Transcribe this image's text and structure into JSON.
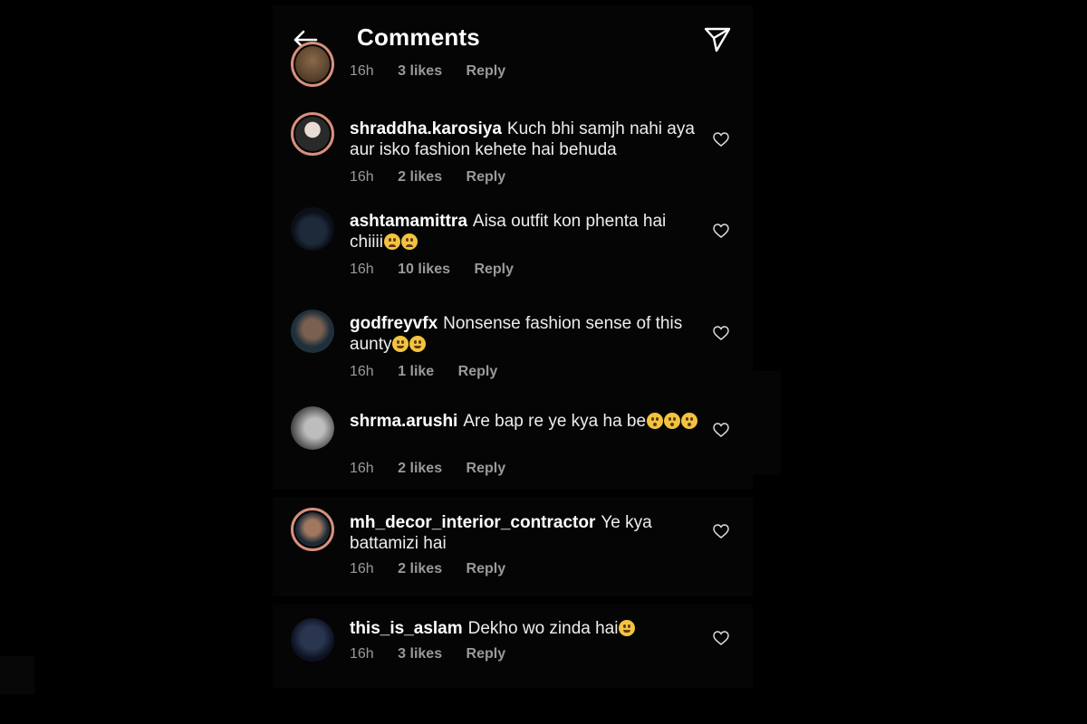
{
  "header": {
    "title": "Comments"
  },
  "icons": {
    "back": "arrow-left-icon",
    "send": "paper-plane-icon",
    "like": "heart-icon"
  },
  "top_meta": {
    "time": "16h",
    "likes": "3 likes",
    "reply": "Reply"
  },
  "comments": [
    {
      "user": "shraddha.karosiya",
      "text": "Kuch bhi samjh nahi aya aur isko fashion kehete hai behuda",
      "emojis": "",
      "time": "16h",
      "likes": "2 likes",
      "reply": "Reply"
    },
    {
      "user": "ashtamamittra",
      "text": "Aisa outfit kon phenta hai chiiii",
      "emojis": "😒😒",
      "time": "16h",
      "likes": "10 likes",
      "reply": "Reply"
    },
    {
      "user": "godfreyvfx",
      "text": "Nonsense fashion sense of this aunty",
      "emojis": "😂😂",
      "time": "16h",
      "likes": "1 like",
      "reply": "Reply"
    },
    {
      "user": "shrma.arushi",
      "text": "Are bap re ye kya ha be",
      "emojis": "😮😮😮",
      "time": "16h",
      "likes": "2 likes",
      "reply": "Reply"
    },
    {
      "user": "mh_decor_interior_contractor",
      "text": "Ye kya battamizi hai",
      "emojis": "",
      "time": "16h",
      "likes": "2 likes",
      "reply": "Reply"
    },
    {
      "user": "this_is_aslam",
      "text": "Dekho wo zinda hai",
      "emojis": "😂",
      "time": "16h",
      "likes": "3 likes",
      "reply": "Reply"
    }
  ],
  "colors": {
    "background": "#000000",
    "panel": "#050505",
    "story_ring": "#d98f7c",
    "muted_text": "#9a9a9a"
  }
}
